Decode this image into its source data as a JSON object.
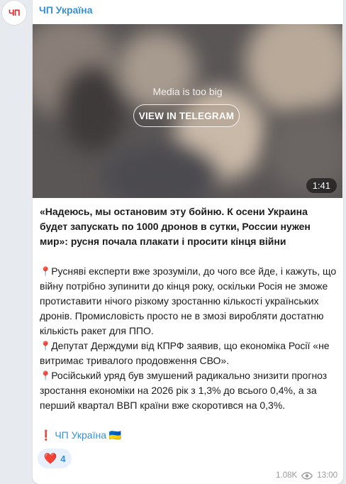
{
  "channel": {
    "avatar_text": "ЧП",
    "name": "ЧП Україна"
  },
  "media": {
    "message": "Media is too big",
    "button_label": "VIEW IN TELEGRAM",
    "duration": "1:41"
  },
  "post": {
    "headline": "«Надеюсь, мы остановим эту бойню. К осени Украина будет запускать по 1000 дронов в сутки, России нужен мир»:",
    "headline_tail": " русня почала плакати і просити кінця війни",
    "paragraphs": [
      "Русняві експерти вже зрозуміли, до чого все йде, і кажуть, що війну потрібно зупинити до кінця року, оскільки Росія не зможе протиставити нічого різкому зростанню кількості українських дронів. Промисловість просто не в змозі виробляти достатню кількість ракет для ППО.",
      "Депутат Держдуми від КПРФ заявив, що економіка Росії «не витримає тривалого продовження СВО».",
      "Російський уряд був змушений радикально знизити прогноз зростання економіки на 2026 рік з 1,3% до всього 0,4%, а за перший квартал ВВП країни вже скоротився на 0,3%."
    ],
    "signature": "ЧП Україна",
    "signature_prefix": "❗",
    "signature_suffix": "🇺🇦",
    "pin_icon": "📍"
  },
  "reactions": [
    {
      "emoji": "❤️",
      "count": "4"
    }
  ],
  "meta": {
    "views": "1.08K",
    "time": "13:00"
  },
  "colors": {
    "accent": "#3a8fd0",
    "background": "#e7ebf0",
    "bubble": "#ffffff"
  }
}
